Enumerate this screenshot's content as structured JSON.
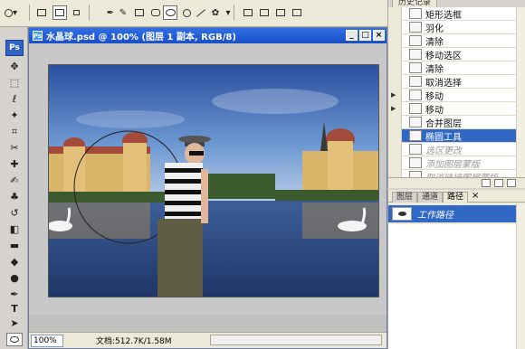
{
  "options_bar": {
    "tools": [
      "marquee-options",
      "new-selection",
      "add-to-selection",
      "rectangle",
      "rounded-rectangle",
      "ellipse",
      "circle",
      "line",
      "custom-shape",
      "dropdown",
      "combine-1",
      "combine-2",
      "combine-3",
      "combine-4"
    ]
  },
  "toolbox": {
    "logo": "Ps",
    "tools": [
      "move",
      "marquee",
      "lasso",
      "magic-wand",
      "crop",
      "slice",
      "healing",
      "brush",
      "clone-stamp",
      "history-brush",
      "eraser",
      "gradient",
      "blur",
      "dodge",
      "pen",
      "type",
      "path-select",
      "shape"
    ]
  },
  "document": {
    "title": "水晶球.psd @ 100% (图层 1 副本, RGB/8)",
    "zoom": "100%",
    "doc_size": "文档:512.7K/1.58M",
    "min_btn": "_",
    "max_btn": "□",
    "close_btn": "×"
  },
  "history": {
    "tab_label": "历史记录",
    "items": [
      {
        "label": "矩形选框",
        "state": "normal",
        "arrow": false
      },
      {
        "label": "羽化",
        "state": "normal",
        "arrow": false
      },
      {
        "label": "清除",
        "state": "normal",
        "arrow": false
      },
      {
        "label": "移动选区",
        "state": "normal",
        "arrow": false
      },
      {
        "label": "清除",
        "state": "normal",
        "arrow": false
      },
      {
        "label": "取消选择",
        "state": "normal",
        "arrow": false
      },
      {
        "label": "移动",
        "state": "normal",
        "arrow": true
      },
      {
        "label": "移动",
        "state": "normal",
        "arrow": true
      },
      {
        "label": "合并图层",
        "state": "normal",
        "arrow": false
      },
      {
        "label": "椭圆工具",
        "state": "active",
        "arrow": false
      },
      {
        "label": "选区更改",
        "state": "undone",
        "arrow": false
      },
      {
        "label": "添加图层蒙版",
        "state": "undone",
        "arrow": false
      },
      {
        "label": "取消链接图层蒙版",
        "state": "undone",
        "arrow": false
      }
    ]
  },
  "paths_panel": {
    "tabs": [
      {
        "label": "图层",
        "active": false
      },
      {
        "label": "通道",
        "active": false
      },
      {
        "label": "路径",
        "active": true
      }
    ],
    "close_label": "×",
    "row_label": "工作路径"
  },
  "colors": {
    "title_blue": "#1a4fc7",
    "selection_blue": "#3168c6",
    "panel_bg": "#ece9d8"
  }
}
